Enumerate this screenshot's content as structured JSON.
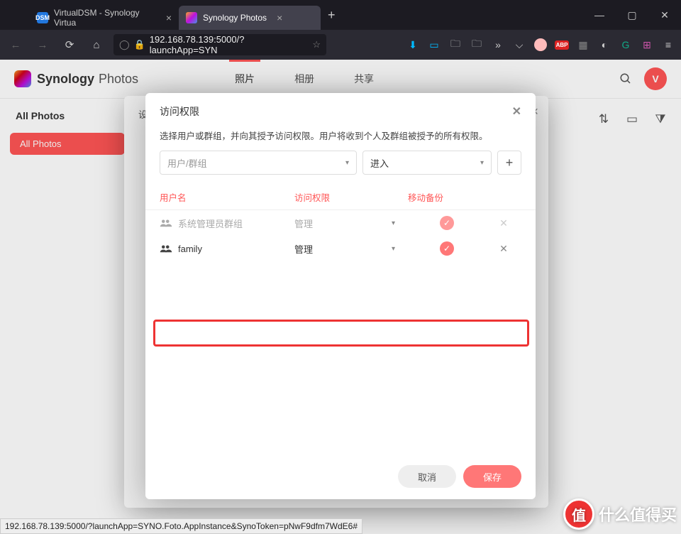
{
  "browser": {
    "tabs": [
      {
        "title": "VirtualDSM - Synology Virtua",
        "favicon_label": "DSM",
        "favicon_bg": "#2277dd"
      },
      {
        "title": "Synology Photos"
      }
    ],
    "url": "192.168.78.139:5000/?launchApp=SYN",
    "status_url": "192.168.78.139:5000/?launchApp=SYNO.Foto.AppInstance&SynoToken=pNwF9dfm7WdE6#"
  },
  "app": {
    "brand": "Synology",
    "brand_sub": "Photos",
    "nav": {
      "photo": "照片",
      "album": "相册",
      "share": "共享"
    },
    "sidebar_title": "All Photos",
    "sidebar_item": "All Photos",
    "avatar_initial": "V",
    "under_nav_label": "设"
  },
  "modal": {
    "title": "访问权限",
    "desc": "选择用户或群组，并向其授予访问权限。用户将收到个人及群组被授予的所有权限。",
    "user_placeholder": "用户/群组",
    "perm_placeholder": "进入",
    "add_label": "+",
    "columns": {
      "user": "用户名",
      "perm": "访问权限",
      "backup": "移动备份"
    },
    "rows": [
      {
        "name": "系统管理员群组",
        "perm": "管理",
        "backup": true,
        "removable": false
      },
      {
        "name": "family",
        "perm": "管理",
        "backup": true,
        "removable": true
      }
    ],
    "cancel": "取消",
    "save": "保存"
  },
  "watermark": {
    "badge": "值",
    "text": "什么值得买"
  }
}
